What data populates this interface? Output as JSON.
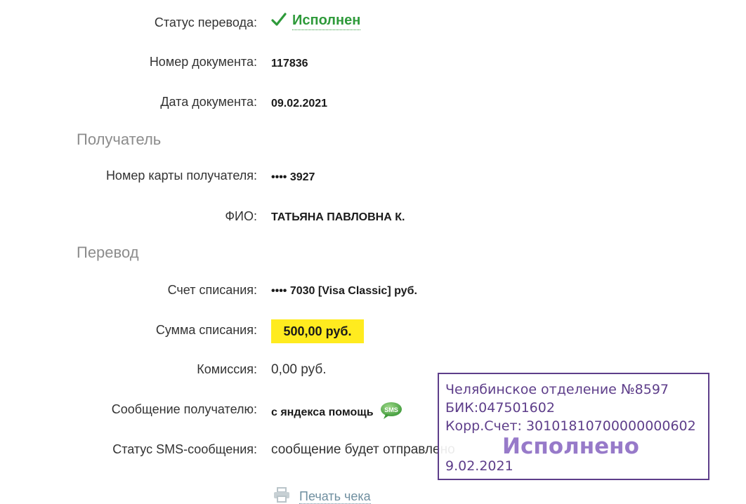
{
  "rows": {
    "status": {
      "label": "Статус перевода:",
      "value": "Исполнен"
    },
    "doc_number": {
      "label": "Номер документа:",
      "value": "117836"
    },
    "doc_date": {
      "label": "Дата документа:",
      "value": "09.02.2021"
    },
    "card_number": {
      "label": "Номер карты получателя:",
      "value": "•••• 3927"
    },
    "fio": {
      "label": "ФИО:",
      "value": "ТАТЬЯНА ПАВЛОВНА К."
    },
    "account": {
      "label": "Счет списания:",
      "value": "•••• 7030  [Visa Classic]  руб."
    },
    "amount": {
      "label": "Сумма списания:",
      "value": "500,00  руб."
    },
    "commission": {
      "label": "Комиссия:",
      "value": "0,00 руб."
    },
    "message": {
      "label": "Сообщение получателю:",
      "value": "с яндекса помощь",
      "icon": "sms-icon",
      "icon_text": "SMS"
    },
    "sms_status": {
      "label": "Статус SMS-сообщения:",
      "value": "сообщение будет отправлено"
    }
  },
  "sections": {
    "recipient": "Получатель",
    "transfer": "Перевод"
  },
  "print": {
    "label": "Печать чека",
    "icon": "printer-icon"
  },
  "stamp": {
    "line1": "Челябинское отделение №8597",
    "line2": "БИК:047501602",
    "line3": "Корр.Счет: 30101810700000000602",
    "status": "Исполнено",
    "date": "9.02.2021"
  },
  "colors": {
    "status_green": "#2e9a3a",
    "highlight_yellow": "#ffeb1f",
    "stamp_purple": "#5e3e8a",
    "section_gray": "#8c8c8c",
    "link_gray_blue": "#6f8fa0"
  }
}
